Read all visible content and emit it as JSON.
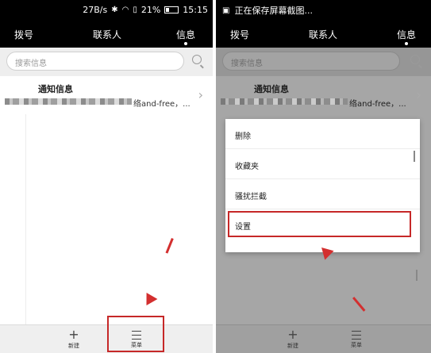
{
  "left": {
    "status": {
      "speed": "27B/s",
      "battery": "21%",
      "time": "15:15"
    },
    "tabs": [
      {
        "label": "拨号"
      },
      {
        "label": "联系人"
      },
      {
        "label": "信息"
      }
    ],
    "search": {
      "placeholder": "搜索信息"
    },
    "conversation": {
      "title": "通知信息",
      "snippet": "络and-free，..."
    },
    "bottom": {
      "new_label": "新建",
      "menu_label": "菜单"
    }
  },
  "right": {
    "status": {
      "notification": "正在保存屏幕截图..."
    },
    "tabs": [
      {
        "label": "拨号"
      },
      {
        "label": "联系人"
      },
      {
        "label": "信息"
      }
    ],
    "search": {
      "placeholder": "搜索信息"
    },
    "conversation": {
      "title": "通知信息",
      "snippet": "络and-free，..."
    },
    "menu": [
      {
        "label": "删除"
      },
      {
        "label": "收藏夹"
      },
      {
        "label": "骚扰拦截"
      },
      {
        "label": "设置"
      }
    ],
    "bottom": {
      "new_label": "新建",
      "menu_label": "菜单"
    }
  },
  "colors": {
    "annotation": "#d32f2f",
    "statusbar": "#000000"
  }
}
